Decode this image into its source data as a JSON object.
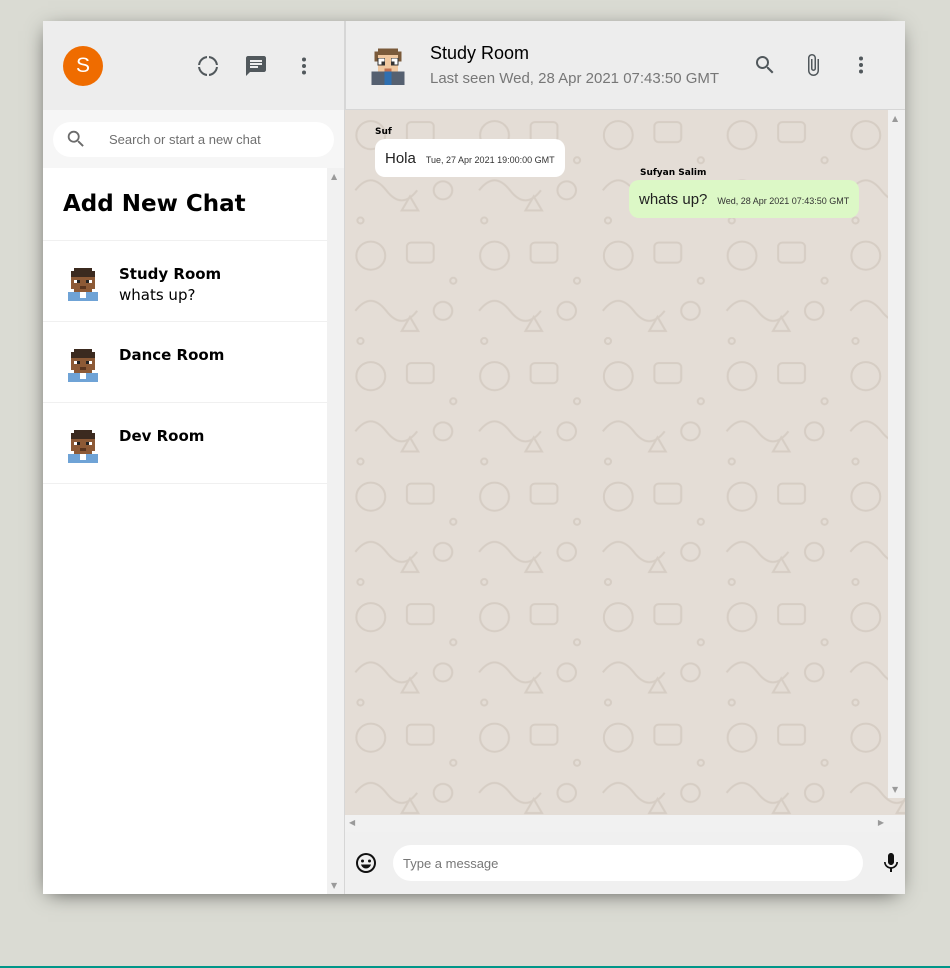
{
  "sidebar": {
    "user_avatar_letter": "S",
    "search_placeholder": "Search or start a new chat",
    "add_new_chat_label": "Add New Chat",
    "chats": [
      {
        "name": "Study Room",
        "last_message": "whats up?"
      },
      {
        "name": "Dance Room",
        "last_message": ""
      },
      {
        "name": "Dev Room",
        "last_message": ""
      }
    ]
  },
  "chat": {
    "room_name": "Study Room",
    "last_seen": "Last seen Wed, 28 Apr 2021 07:43:50 GMT",
    "messages": [
      {
        "sender": "Suf",
        "text": "Hola",
        "time": "Tue, 27 Apr 2021 19:00:00 GMT",
        "mine": false
      },
      {
        "sender": "Sufyan Salim",
        "text": "whats up?",
        "time": "Wed, 28 Apr 2021 07:43:50 GMT",
        "mine": true
      }
    ],
    "input_placeholder": "Type a message"
  },
  "icons": {
    "status": "status-icon",
    "new_chat": "chat-icon",
    "menu": "more-vert-icon",
    "search": "search-icon",
    "attach": "attach-icon",
    "emoji": "emoji-icon",
    "mic": "mic-icon"
  },
  "colors": {
    "avatar_orange": "#ef6c00",
    "my_bubble": "#dcf8c6",
    "chat_background": "#e4ddd6"
  }
}
